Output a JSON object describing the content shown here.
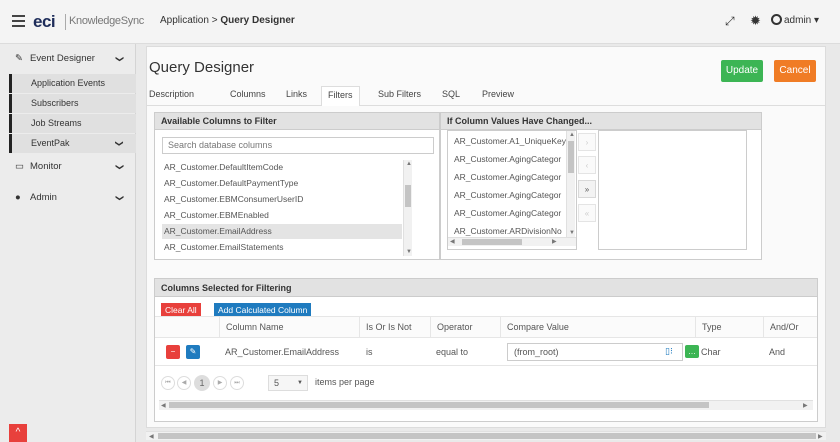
{
  "topbar": {
    "logo": "eci",
    "product": "KnowledgeSync",
    "breadcrumb_parent": "Application >",
    "breadcrumb_current": "Query Designer",
    "user": "admin",
    "user_caret": "▾",
    "expand_icon_glyph": "⤢",
    "gear_icon_glyph": "✹"
  },
  "sidebar": {
    "event_designer": "Event Designer",
    "application_events": "Application Events",
    "subscribers": "Subscribers",
    "job_streams": "Job Streams",
    "eventpak": "EventPak",
    "monitor": "Monitor",
    "admin": "Admin",
    "chevron": "❯",
    "up_arrow": "^"
  },
  "page": {
    "title": "Query Designer",
    "update_label": "Update",
    "cancel_label": "Cancel",
    "tabs": [
      "Description",
      "Columns",
      "Links",
      "Filters",
      "Sub Filters",
      "SQL",
      "Preview"
    ],
    "active_tab": "Filters"
  },
  "available_columns": {
    "header": "Available Columns to Filter",
    "search_placeholder": "Search database columns",
    "items": [
      "AR_Customer.DefaultItemCode",
      "AR_Customer.DefaultPaymentType",
      "AR_Customer.EBMConsumerUserID",
      "AR_Customer.EBMEnabled",
      "AR_Customer.EmailAddress",
      "AR_Customer.EmailStatements"
    ],
    "selected_item": "AR_Customer.EmailAddress"
  },
  "changed_columns": {
    "header": "If Column Values Have Changed...",
    "items": [
      "AR_Customer.A1_UniqueKey",
      "AR_Customer.AgingCategor",
      "AR_Customer.AgingCategor",
      "AR_Customer.AgingCategor",
      "AR_Customer.AgingCategor",
      "AR_Customer.ARDivisionNo"
    ],
    "move_buttons": [
      "›",
      "‹",
      "»",
      "«"
    ]
  },
  "filter_grid": {
    "header": "Columns Selected for Filtering",
    "clear_all_label": "Clear All",
    "add_calc_label": "Add Calculated Column",
    "columns": [
      "Column Name",
      "Is Or Is Not",
      "Operator",
      "Compare Value",
      "Type",
      "And/Or"
    ],
    "row": {
      "column_name": "AR_Customer.EmailAddress",
      "is_or_is_not": "is",
      "operator": "equal to",
      "compare_value": "(from_root)",
      "type": "Char",
      "and_or": "And"
    },
    "pager": {
      "current_page": "1",
      "page_size": "5",
      "items_per_page_label": "items per page"
    }
  },
  "colors": {
    "update": "#3cb554",
    "cancel": "#f07c25",
    "clear_all": "#e8403c",
    "add_calc": "#1f7bbf"
  }
}
